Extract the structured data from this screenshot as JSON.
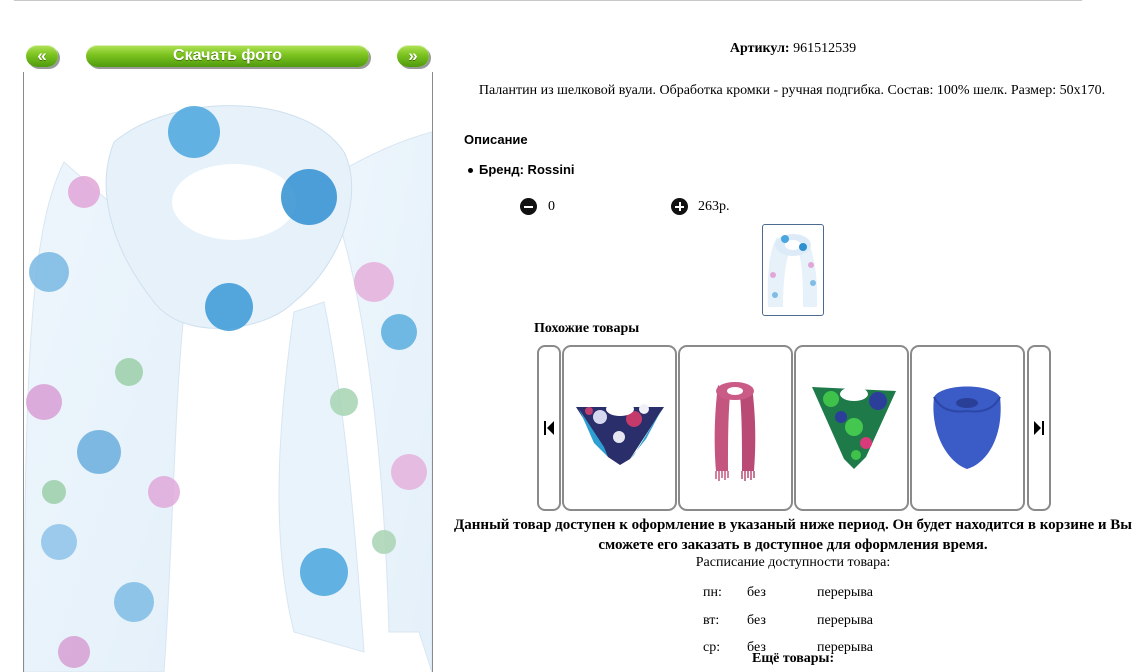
{
  "gallery": {
    "prev_label": "«",
    "download_label": "Скачать фото",
    "next_label": "»"
  },
  "product": {
    "article_label": "Артикул:",
    "article_value": "961512539",
    "description": "Палантин из шелковой вуали. Обработка кромки - ручная подгибка. Состав: 100% шелк. Размер: 50x170.",
    "section_title": "Описание",
    "brand": "Бренд: Rossini",
    "quantity": "0",
    "price": "263р."
  },
  "similar": {
    "title": "Похожие товары"
  },
  "availability": {
    "notice": "Данный товар доступен к оформление в указаный ниже период. Он будет находится в корзине и Вы сможете его заказать в доступное для оформления время.",
    "schedule_title": "Расписание доступности товара:",
    "rows": [
      {
        "day": "пн:",
        "a": "без",
        "b": "перерыва"
      },
      {
        "day": "вт:",
        "a": "без",
        "b": "перерыва"
      },
      {
        "day": "ср:",
        "a": "без",
        "b": "перерыва"
      }
    ],
    "more_label": "Ещё товары:"
  },
  "icons": {
    "minus": "minus-circle-icon",
    "plus": "plus-circle-icon",
    "first": "skip-first-icon",
    "last": "skip-last-icon"
  },
  "colors": {
    "button_green": "#7cc31f",
    "thumb_border": "#4a6a90",
    "card_border": "#8a8a8a"
  }
}
